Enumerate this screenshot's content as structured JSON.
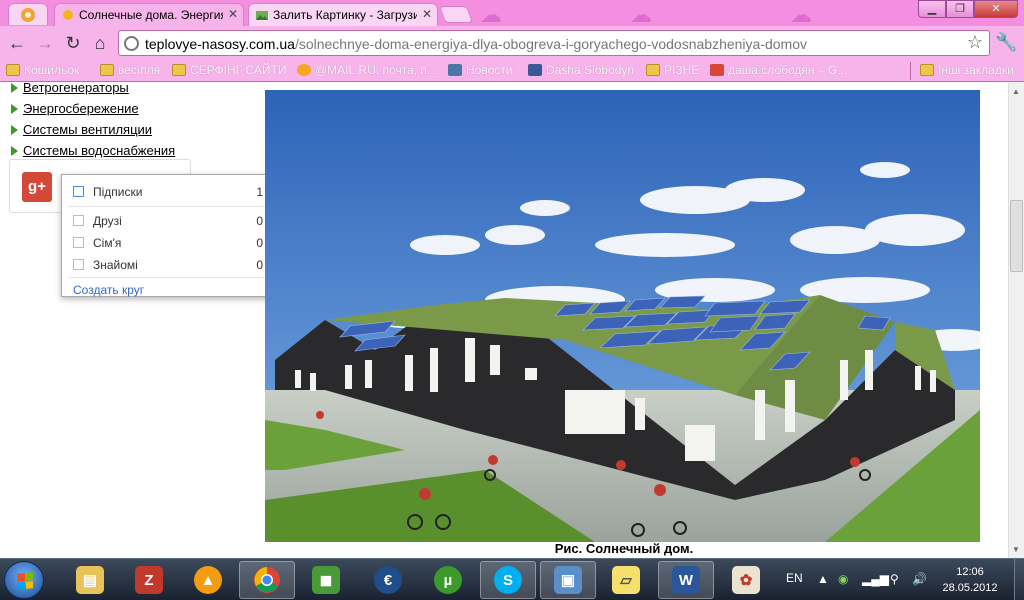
{
  "browser": {
    "tabs": [
      {
        "title": "Солнечные дома. Энергия",
        "active": true
      },
      {
        "title": "Залить Картинку - Загрузи",
        "active": false
      }
    ],
    "address": {
      "host": "teplovye-nasosy.com.ua",
      "path": "/solnechnye-doma-energiya-dlya-obogreva-i-goryachego-vodosnabzheniya-domov"
    },
    "bookmarks": [
      {
        "label": "Кошильок",
        "icon": "folder"
      },
      {
        "label": "весілля",
        "icon": "folder"
      },
      {
        "label": "СЕРФІНГ САЙТИ",
        "icon": "folder"
      },
      {
        "label": "@MAIL.RU: почта, п...",
        "icon": "mailru"
      },
      {
        "label": "Новости",
        "icon": "vk"
      },
      {
        "label": "Dasha Slobodyn",
        "icon": "facebook"
      },
      {
        "label": "РІЗНЕ",
        "icon": "folder"
      },
      {
        "label": "даша слободян – G...",
        "icon": "gplus"
      },
      {
        "label": "Інші закладки",
        "icon": "folder"
      }
    ]
  },
  "page": {
    "menu": [
      "Ветрогенераторы",
      "Энергосбережение",
      "Системы вентиляции",
      "Системы водоснабжения"
    ],
    "gplus": {
      "button_label": "g+",
      "circles": [
        {
          "name": "Підписки",
          "count": "1"
        },
        {
          "name": "Друзі",
          "count": "0"
        },
        {
          "name": "Сім'я",
          "count": "0"
        },
        {
          "name": "Знайомі",
          "count": "0"
        }
      ],
      "create_label": "Создать круг"
    },
    "caption": "Рис. Солнечный дом."
  },
  "taskbar": {
    "lang": "EN",
    "time": "12:06",
    "date": "28.05.2012",
    "apps": [
      "explorer",
      "filezilla",
      "aimp",
      "chrome",
      "3d-app",
      "euro-app",
      "utorrent",
      "skype",
      "photo-viewer",
      "sticky-notes",
      "word",
      "paint"
    ]
  },
  "colors": {
    "chrome_pink": "#f48ee0",
    "toolbar_pink": "#f7b4ea",
    "gplus_red": "#d34836",
    "link_blue": "#3366cc",
    "bullet_green": "#3a9a2a"
  }
}
